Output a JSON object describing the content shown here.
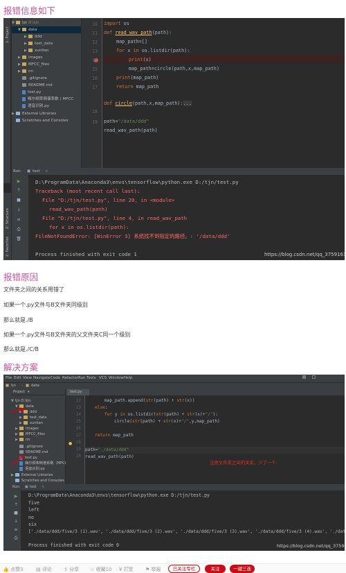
{
  "sections": {
    "error_title": "报错信息如下",
    "cause_title": "报错原因",
    "solution_title": "解决方案"
  },
  "cause_paragraphs": [
    "文件夹之间的关系用错了",
    "如果一个.py文件与B文件夹同级别",
    "那么就是./B",
    "如果一个.py文件与B文件夹的父文件夹C同一个级别",
    "那么就是./C/B"
  ],
  "shot1": {
    "tree": {
      "project": "tjn",
      "project_path": "D:\\tjn",
      "items": [
        "data",
        "ddd",
        "test_data",
        "xunlian",
        "images",
        "MFCC_files",
        "nn",
        ".gitignore",
        "README.md",
        "test.py",
        "梅尔频率倒谱系数 ( MFCC",
        "语音识别.py",
        "External Libraries",
        "Scratches and Consoles"
      ]
    },
    "side_labels": {
      "project": "1: Project",
      "structure": "Z: Structure",
      "favorites": "2: Favorites"
    },
    "line_numbers": [
      "10",
      "11",
      "12",
      "13",
      "14",
      "15",
      "16",
      "17",
      "18",
      "19"
    ],
    "code_lines": [
      "import os",
      "def read_wav_path(path):",
      "map_path=[]",
      "for x in os.listdir(path):",
      "print(x)",
      "map_path=circle(path,x,map_path)",
      "print(map_path)",
      "return map_path",
      "def circle(path,x,map_path):...",
      "path=\"/data/ddd\"",
      "read_wav_path(path)"
    ],
    "run": {
      "tab_label": "Run:",
      "tab_name": "test",
      "lines": [
        "D:\\ProgramData\\Anaconda3\\envs\\tensorflow\\python.exe D:/tjn/test.py",
        "Traceback (most recent call last):",
        "File \"D:/tjn/test.py\", line 20, in <module>",
        "read_wav_path(path)",
        "File \"D:/tjn/test.py\", line 4, in read_wav_path",
        "for x in os.listdir(path):",
        "FileNotFoundError: [WinError 3] 系统找不到指定的路径。: '/data/ddd'",
        "Process finished with exit code 1"
      ]
    },
    "watermark": "https://blog.csdn.net/qq_37591637"
  },
  "shot2": {
    "menu": [
      "File",
      "Edit",
      "View",
      "Navigate",
      "Code",
      "Refactor",
      "Run",
      "Tools",
      "VCS",
      "Window",
      "Help"
    ],
    "crumbs": [
      "tjn",
      "data"
    ],
    "tab": "test.py",
    "project_label": "Project",
    "tree": [
      "tjn D:\\tjn",
      "data",
      "ddd",
      "test_data",
      "xunlian",
      "images",
      "MFCC_files",
      "nn",
      ".gitignore",
      "README.md",
      "test.py",
      "梅尔频率倒谱系数（MFCC",
      "语音识别.py",
      "External Libraries",
      "Scratches and Consoles"
    ],
    "line_numbers": [
      "12",
      "13",
      "14",
      "15",
      "16",
      "17",
      "18",
      "19",
      "20"
    ],
    "code_lines": [
      "map_path.append(str(path) + str(x))",
      "else:",
      "for y in os.listdir(str(path) + str(x)+\"/\"):",
      "circle(str(path) + str(x)+\"/\",y,map_path)",
      "return map_path",
      "path=\"./data/ddd\"",
      "read_wav_path(path)"
    ],
    "annotation": "注意文件夹之间的关系，少了一个.",
    "run": {
      "tab_label": "Run:",
      "tab_name": "test",
      "lines": [
        "D:\\ProgramData\\Anaconda3\\envs\\tensorflow\\python.exe D:/tjn/test.py",
        "five",
        "left",
        "no",
        "six",
        "['./data/ddd/five/3 (1).wav', './data/ddd/five/3 (2).wav', './data/ddd/five/3 (3).wav', './data/ddd/five/3 (4).wav', './data/ddd",
        "Process finished with exit code 0"
      ]
    },
    "watermark": "https://blog.csdn.net/qq_37591637"
  },
  "actions": {
    "like": "点赞3",
    "comment": "评论",
    "share": "分享",
    "favorite": "收藏10",
    "tip": "打赏",
    "report": "举报",
    "follow": "关注",
    "subscribe": "一键三连",
    "followed": "已关注专栏"
  },
  "colors": {
    "accent": "#c6589a",
    "error": "#ff6b68",
    "link": "#5994d6",
    "ide_bg": "#2b2b2b",
    "panel_bg": "#3c3f41",
    "brand_red": "#ca0c16"
  }
}
